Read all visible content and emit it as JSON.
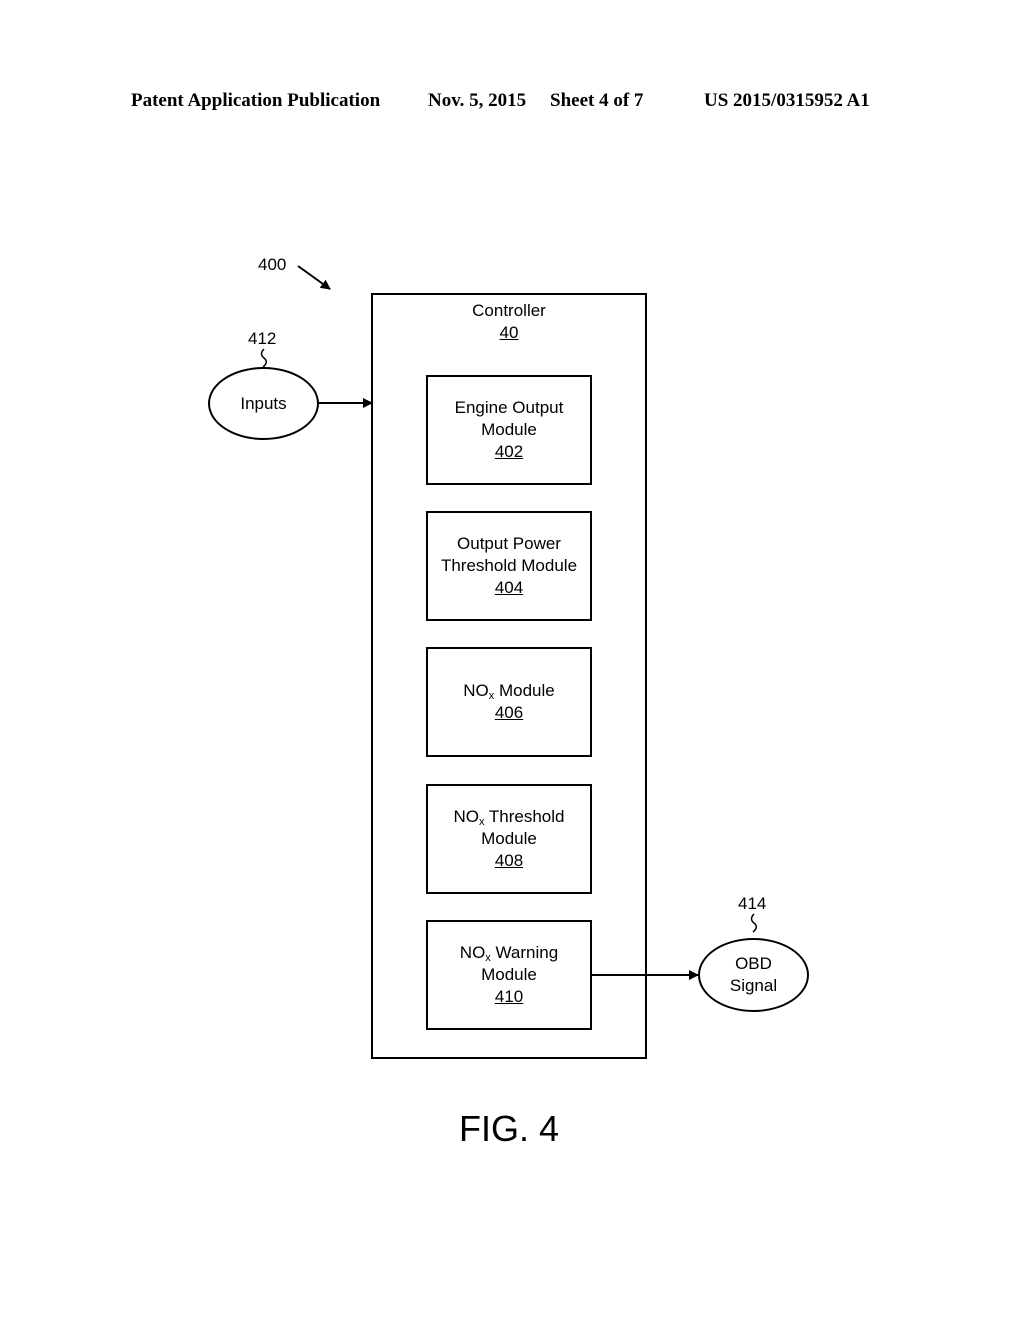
{
  "header": {
    "publication": "Patent Application Publication",
    "date": "Nov. 5, 2015",
    "sheet": "Sheet 4 of 7",
    "number": "US 2015/0315952 A1"
  },
  "diagram": {
    "ref": "400",
    "controller": {
      "label": "Controller",
      "ref": "40"
    },
    "modules": [
      {
        "line1": "Engine Output",
        "line2": "Module",
        "ref": "402"
      },
      {
        "line1": "Output Power",
        "line2": "Threshold Module",
        "ref": "404"
      },
      {
        "prefix": "NO",
        "sub": "x",
        "suffix": " Module",
        "ref": "406"
      },
      {
        "prefix": "NO",
        "sub": "x",
        "suffix": " Threshold",
        "line2": "Module",
        "ref": "408"
      },
      {
        "prefix": "NO",
        "sub": "x",
        "suffix": " Warning",
        "line2": "Module",
        "ref": "410"
      }
    ],
    "inputs": {
      "label": "Inputs",
      "ref": "412"
    },
    "output": {
      "line1": "OBD",
      "line2": "Signal",
      "ref": "414"
    }
  },
  "figure_label": "FIG. 4"
}
